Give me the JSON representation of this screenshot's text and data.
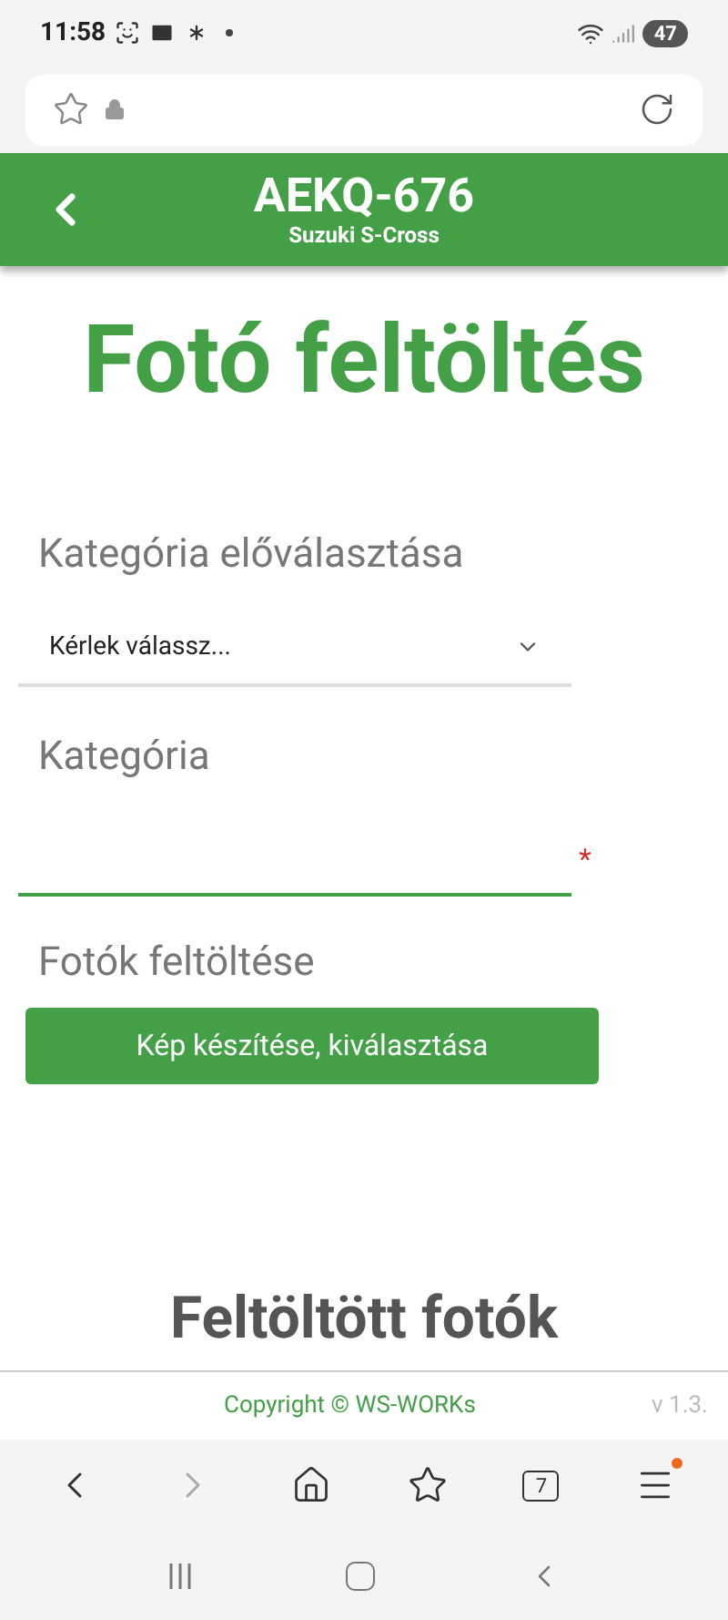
{
  "status_bar": {
    "time": "11:58",
    "battery": "47"
  },
  "header": {
    "title": "AEKQ-676",
    "subtitle": "Suzuki S-Cross"
  },
  "page_title": "Fotó feltöltés",
  "preselect": {
    "label": "Kategória előválasztása",
    "value": "Kérlek válassz..."
  },
  "category": {
    "label": "Kategória",
    "required_mark": "*",
    "focused": true
  },
  "upload": {
    "label": "Fotók feltöltése",
    "button": "Kép készítése, kiválasztása"
  },
  "uploaded_heading": "Feltöltött fotók",
  "footer": {
    "copyright": "Copyright © WS-WORKs",
    "version": "v 1.3."
  },
  "browser_toolbar": {
    "tabs_count": "7",
    "menu_badge": true
  }
}
